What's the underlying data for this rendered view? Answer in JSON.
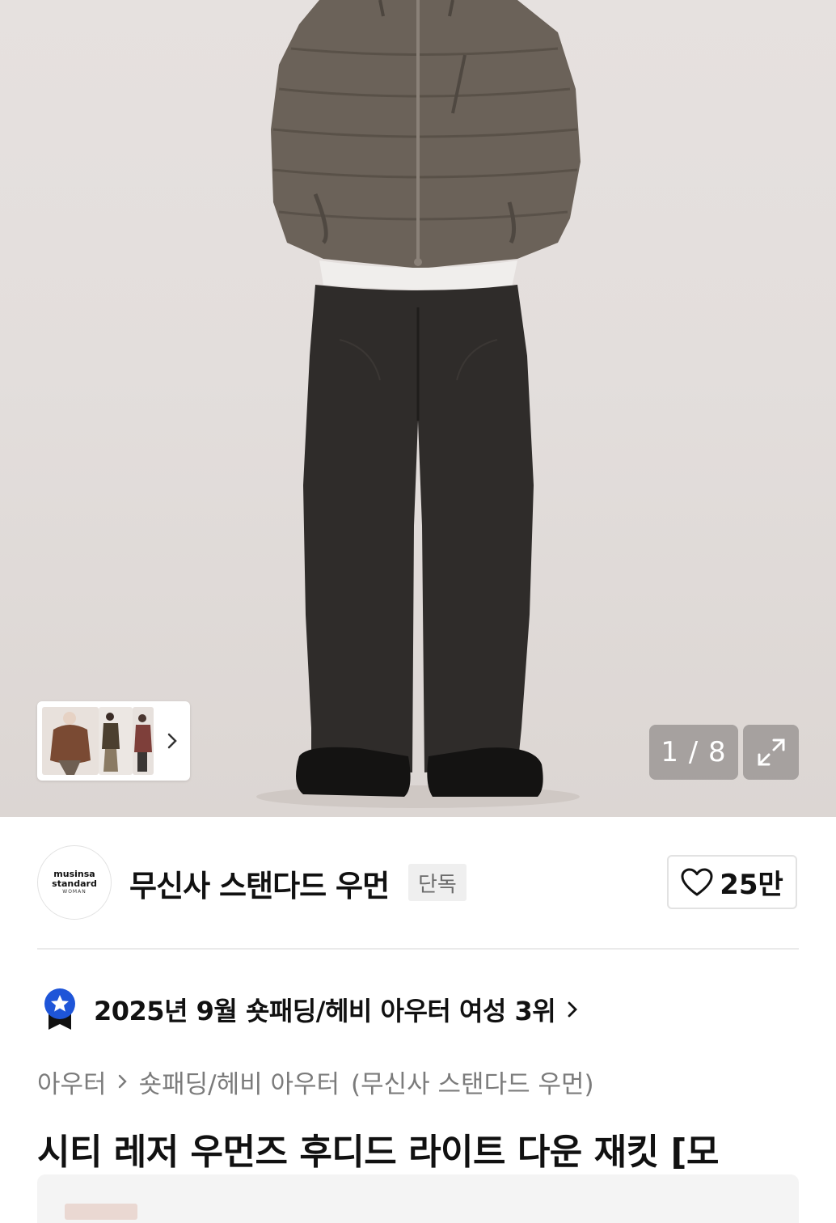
{
  "gallery": {
    "counter_text": "1 / 8",
    "current_index": 1,
    "total_images": 8,
    "expand_icon": "expand-arrows-icon",
    "thumb_next_icon": "chevron-right-icon"
  },
  "brand": {
    "logo_line1": "musinsa",
    "logo_line2": "standard",
    "logo_line3": "WOMAN",
    "name": "무신사 스탠다드 우먼",
    "badge": "단독",
    "like_icon": "heart-icon",
    "like_count": "25만"
  },
  "ranking": {
    "icon": "star-ribbon-icon",
    "text": "2025년 9월 숏패딩/헤비 아우터 여성 3위",
    "accent_color": "#1e55d8"
  },
  "breadcrumb": {
    "level1": "아우터",
    "level2": "숏패딩/헤비 아우터",
    "brand": "(무신사 스탠다드 우먼)"
  },
  "product": {
    "title": "시티 레저 우먼즈 후디드 라이트 다운 재킷 [모"
  }
}
